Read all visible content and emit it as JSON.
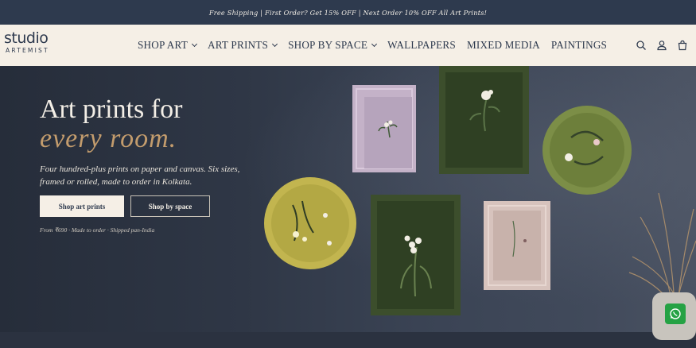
{
  "announcement": "Free Shipping | First Order? Get 15% OFF | Next Order 10% OFF All Art Prints!",
  "brand": {
    "word": "studio",
    "sub": "ARTEMIST"
  },
  "nav": [
    {
      "label": "SHOP ART",
      "dropdown": true
    },
    {
      "label": "ART PRINTS",
      "dropdown": true
    },
    {
      "label": "SHOP BY SPACE",
      "dropdown": true
    },
    {
      "label": "WALLPAPERS",
      "dropdown": false
    },
    {
      "label": "MIXED MEDIA",
      "dropdown": false
    },
    {
      "label": "PAINTINGS",
      "dropdown": false
    }
  ],
  "header_icons": [
    "search-icon",
    "account-icon",
    "cart-icon"
  ],
  "hero": {
    "title_line1": "Art prints for",
    "title_line2": "every room.",
    "description": "Four hundred-plus prints on paper and canvas. Six sizes, framed or rolled, made to order in Kolkata.",
    "primary_cta": "Shop art prints",
    "secondary_cta": "Shop by space",
    "meta": "From ₹690 · Made to order · Shipped pan-India"
  },
  "colors": {
    "navy": "#2e3a4e",
    "cream": "#f5efe6",
    "gold": "#c39c6d",
    "whatsapp": "#25a244"
  },
  "chat_widget": "whatsapp-icon"
}
